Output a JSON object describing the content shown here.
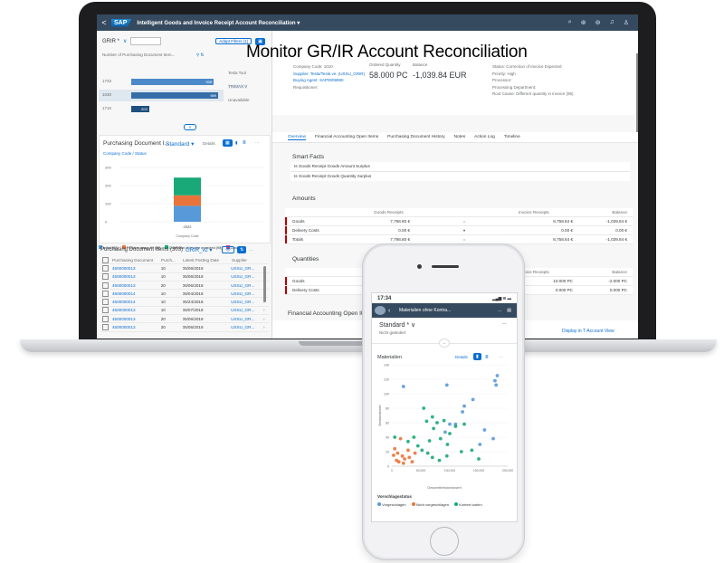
{
  "overlay_title": "Monitor GR/IR Account Reconciliation",
  "laptop": {
    "shell": {
      "back": "<",
      "logo": "SAP",
      "title": "Intelligent Goods and Invoice Receipt Account Reconciliation ▾",
      "icons": [
        "search-icon",
        "copilot-icon",
        "help-icon",
        "bell-icon",
        "user-icon"
      ]
    },
    "left": {
      "variant": "GRIR *",
      "adapt_filters": "Adapt Filters (1)",
      "kpi_label": "Number of Purchasing Document Item...",
      "kpi_bars": [
        {
          "label": "1733",
          "value": "939"
        },
        {
          "label": "1030",
          "value": "989"
        },
        {
          "label": "1710",
          "value": "203"
        }
      ],
      "side_labels": [
        "Tesla Tool",
        "TRIMAX V",
        "Unavailable"
      ],
      "chart_card_title": "Purchasing Document I...",
      "chart_variant": "Standard ▾",
      "chart_details": "Details",
      "chart_breadcrumb": "Company Code / Status",
      "chart_ticks": [
        "300",
        "200",
        "100",
        "0"
      ],
      "chart_x": "2022",
      "chart_axis": "Company Code",
      "legend": [
        "Initial (88)",
        "Problem descr. fill (58)",
        "Correction of invoice expected (98)",
        "Clos..."
      ],
      "table_title": "Purchasing Document Items (303)",
      "table_variant": "GRIR_v2 ▾",
      "columns": [
        "Purchasing Document",
        "Purch...",
        "Latest Posting Date",
        "Supplier"
      ],
      "rows": [
        [
          "4500000013",
          "10",
          "05/06/2018",
          "USSU_GR..."
        ],
        [
          "4500000013",
          "10",
          "05/06/2018",
          "USSU_GR..."
        ],
        [
          "4500000013",
          "20",
          "05/06/2018",
          "USSU_GR..."
        ],
        [
          "4500000014",
          "10",
          "05/04/2018",
          "USSU_GR..."
        ],
        [
          "4500000014",
          "10",
          "05/24/2018",
          "USSU_GR..."
        ],
        [
          "4500000013",
          "10",
          "05/07/2018",
          "USSU_GR..."
        ],
        [
          "4500000013",
          "20",
          "05/06/2018",
          "USSU_GR..."
        ],
        [
          "4500000013",
          "20",
          "05/06/2018",
          "USSU_GR..."
        ]
      ]
    },
    "right": {
      "header_left": [
        "Company Code: 1010",
        "Supplier: Tesla/Tesla ve. (USSU_GRIR)",
        "Buying Agent: SAP0009990",
        "Requisitioner:"
      ],
      "ordered_qty_label": "Ordered Quantity",
      "ordered_qty": "58.000 PC",
      "balance_label": "Balance",
      "balance": "-1,039.84 EUR",
      "header_right": [
        "Status: Correction of Invoice Expected",
        "Priority: High",
        "Processor:",
        "Processing Department:",
        "Root Cause: Different quantity in invoice (95)"
      ],
      "tabs": [
        "Overview",
        "Financial Accounting Open Items",
        "Purchasing Document History",
        "Notes",
        "Action Log",
        "Timeline"
      ],
      "smart_facts_title": "Smart Facts",
      "smart_facts": [
        "Is Goods Receipt Goods Amount Surplus",
        "Is Goods Receipt Goods Quantity Surplus"
      ],
      "amounts_title": "Amounts",
      "amount_cols": [
        "Goods Receipts",
        "Invoice Receipts",
        "Balance"
      ],
      "amount_rows": [
        {
          "name": "Goods",
          "gr": "7,798.80 €",
          "op": "=",
          "ir": "8,758.64 €",
          "bal": "-1,039.84 €"
        },
        {
          "name": "Delivery Costs",
          "gr": "0.00 €",
          "op": "●",
          "ir": "0.00 €",
          "bal": "0.00 €"
        },
        {
          "name": "Totals",
          "gr": "7,798.80 €",
          "op": "=",
          "ir": "8,758.64 €",
          "bal": "-1,039.84 €"
        }
      ],
      "quantities_title": "Quantities",
      "qty_cols": [
        "Invoice Receipts",
        "Balance"
      ],
      "qty_rows": [
        {
          "name": "Goods",
          "ir": "10.000 PC",
          "bal": "-2.000 PC"
        },
        {
          "name": "Delivery Costs",
          "ir": "0.000 PC",
          "bal": "0.000 PC"
        }
      ],
      "fi_title": "Financial Accounting Open It...",
      "display_tav": "Display in T-Account View"
    }
  },
  "phone": {
    "time": "17:34",
    "signal": "▂▄▆ ≋ ▬",
    "shell_title": "Materialien ohne Kontra...",
    "shell_more": "...",
    "variant": "Standard * ∨",
    "variant_sub": "Nicht geändert",
    "chart_title": "Materialien",
    "details": "Details",
    "ylabel": "Bestandswert",
    "xlabel": "Gesamtbestandswert",
    "legend_title": "Vorschlagsstatus",
    "legend": [
      "Vorgeschlagen",
      "Nicht vorgeschlagen",
      "Kontext wahrn"
    ]
  },
  "chart_data": {
    "type": "scatter",
    "xlabel": "Gesamtbestandswert",
    "ylabel": "Bestandswert",
    "x_ticks": [
      "0",
      "50,000",
      "100,000",
      "150,000",
      "200,000"
    ],
    "y_ticks": [
      "0",
      "20",
      "40",
      "60",
      "80",
      "100",
      "120",
      "140"
    ],
    "xlim": [
      0,
      200000
    ],
    "ylim": [
      0,
      140
    ],
    "series": [
      {
        "name": "Vorgeschlagen",
        "color": "#5899da",
        "points": [
          [
            20000,
            110
          ],
          [
            95000,
            112
          ],
          [
            178000,
            118
          ],
          [
            182000,
            125
          ],
          [
            180000,
            112
          ],
          [
            140000,
            92
          ],
          [
            125000,
            83
          ],
          [
            122000,
            75
          ],
          [
            110000,
            58
          ],
          [
            92000,
            47
          ],
          [
            160000,
            50
          ],
          [
            175000,
            38
          ],
          [
            152000,
            30
          ],
          [
            100000,
            58
          ]
        ]
      },
      {
        "name": "Nicht vorgeschlagen",
        "color": "#e8743b",
        "points": [
          [
            15000,
            38
          ],
          [
            5000,
            24
          ],
          [
            10000,
            18
          ],
          [
            18000,
            14
          ],
          [
            22000,
            10
          ],
          [
            8000,
            8
          ],
          [
            20000,
            4
          ],
          [
            30000,
            12
          ],
          [
            3000,
            15
          ],
          [
            12000,
            6
          ],
          [
            35000,
            6
          ],
          [
            28000,
            22
          ],
          [
            40000,
            18
          ]
        ]
      },
      {
        "name": "Kontext wahrn",
        "color": "#19a979",
        "points": [
          [
            55000,
            80
          ],
          [
            70000,
            68
          ],
          [
            60000,
            62
          ],
          [
            90000,
            63
          ],
          [
            78000,
            60
          ],
          [
            72000,
            52
          ],
          [
            110000,
            55
          ],
          [
            125000,
            58
          ],
          [
            100000,
            45
          ],
          [
            84000,
            38
          ],
          [
            96000,
            30
          ],
          [
            65000,
            35
          ],
          [
            45000,
            28
          ],
          [
            52000,
            22
          ],
          [
            62000,
            18
          ],
          [
            70000,
            12
          ],
          [
            82000,
            8
          ],
          [
            95000,
            14
          ],
          [
            120000,
            20
          ],
          [
            138000,
            22
          ],
          [
            150000,
            10
          ],
          [
            5000,
            40
          ],
          [
            38000,
            40
          ],
          [
            28000,
            34
          ]
        ]
      }
    ]
  },
  "laptop_chart_data": {
    "type": "bar",
    "categories": [
      "2022"
    ],
    "series": [
      {
        "name": "Initial (88)",
        "color": "#5899da",
        "values": [
          88
        ]
      },
      {
        "name": "Problem descr. fill (58)",
        "color": "#e8743b",
        "values": [
          58
        ]
      },
      {
        "name": "Correction of invoice expected (98)",
        "color": "#19a979",
        "values": [
          98
        ]
      }
    ],
    "ylim": [
      0,
      300
    ]
  },
  "colors": {
    "shell": "#354a5f",
    "accent": "#0a6ed1",
    "negative": "#bb0000"
  }
}
